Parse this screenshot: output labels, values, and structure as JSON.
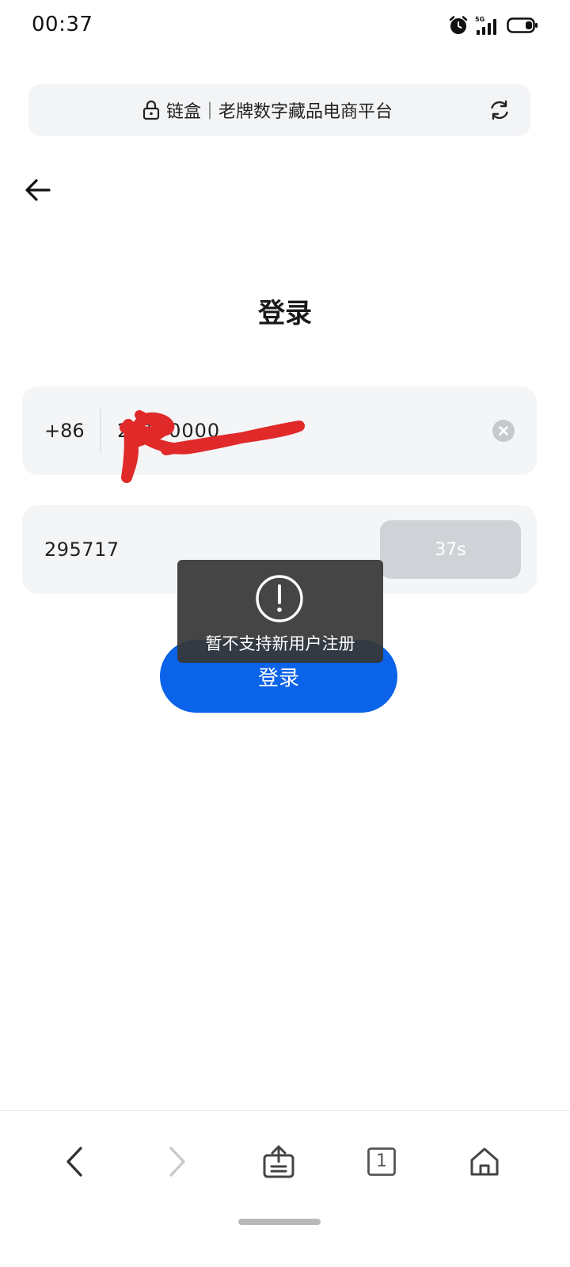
{
  "status_bar": {
    "time": "00:37",
    "network_label": "5G",
    "icons": [
      "alarm-icon",
      "signal-icon",
      "battery-icon"
    ]
  },
  "browser": {
    "page_title": "链盒｜老牌数字藏品电商平台",
    "icons": [
      "lock-icon",
      "refresh-icon"
    ]
  },
  "page": {
    "back_icon": "back-arrow-icon",
    "title": "登录"
  },
  "phone_field": {
    "country_code": "+86",
    "value": "20100000",
    "clear_icon": "clear-icon"
  },
  "code_field": {
    "value": "295717",
    "countdown": "37s"
  },
  "login_button": {
    "label": "登录"
  },
  "toast": {
    "icon": "exclamation-icon",
    "message": "暂不支持新用户注册"
  },
  "bottom_nav": {
    "tab_count": "1",
    "icons": [
      "back-icon",
      "forward-icon",
      "share-icon",
      "tabs-icon",
      "home-icon"
    ]
  },
  "colors": {
    "primary": "#0a63e8",
    "field_bg": "#f4f5f7",
    "countdown_bg": "#cfd2d6",
    "toast_bg": "#373737",
    "redaction": "#e02a2a"
  }
}
